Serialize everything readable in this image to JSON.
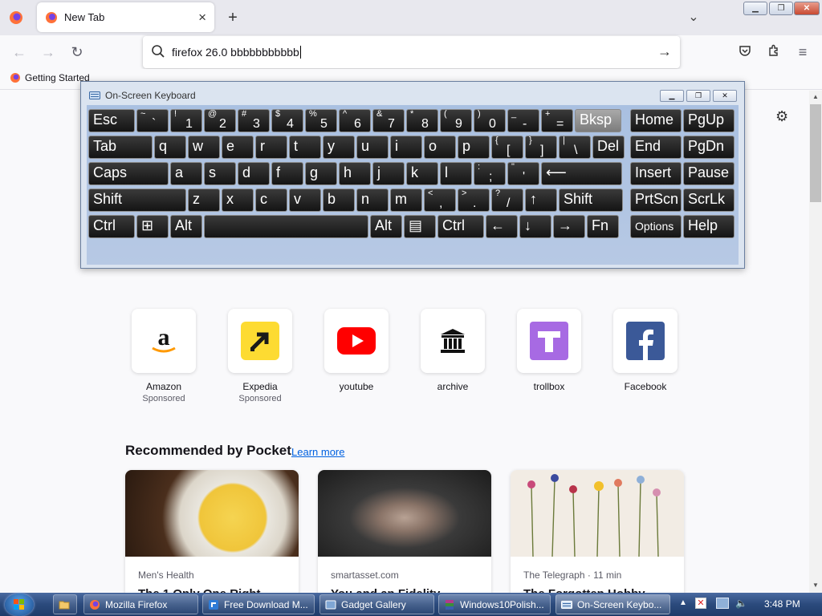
{
  "browser": {
    "tab_title": "New Tab",
    "url_value": "firefox 26.0 bbbbbbbbbbb",
    "bookmark": "Getting Started"
  },
  "osk": {
    "title": "On-Screen Keyboard",
    "rows": [
      [
        {
          "l": "Esc"
        },
        {
          "u": "~",
          "d": "`"
        },
        {
          "u": "!",
          "d": "1"
        },
        {
          "u": "@",
          "d": "2"
        },
        {
          "u": "#",
          "d": "3"
        },
        {
          "u": "$",
          "d": "4"
        },
        {
          "u": "%",
          "d": "5"
        },
        {
          "u": "^",
          "d": "6"
        },
        {
          "u": "&",
          "d": "7"
        },
        {
          "u": "*",
          "d": "8"
        },
        {
          "u": "(",
          "d": "9"
        },
        {
          "u": ")",
          "d": "0"
        },
        {
          "u": "_",
          "d": "-"
        },
        {
          "u": "+",
          "d": "="
        },
        {
          "l": "Bksp"
        },
        {
          "l": "Home"
        },
        {
          "l": "PgUp"
        }
      ],
      [
        {
          "l": "Tab"
        },
        {
          "l": "q"
        },
        {
          "l": "w"
        },
        {
          "l": "e"
        },
        {
          "l": "r"
        },
        {
          "l": "t"
        },
        {
          "l": "y"
        },
        {
          "l": "u"
        },
        {
          "l": "i"
        },
        {
          "l": "o"
        },
        {
          "l": "p"
        },
        {
          "u": "{",
          "d": "["
        },
        {
          "u": "}",
          "d": "]"
        },
        {
          "u": "|",
          "d": "\\"
        },
        {
          "l": "Del"
        },
        {
          "l": "End"
        },
        {
          "l": "PgDn"
        }
      ],
      [
        {
          "l": "Caps"
        },
        {
          "l": "a"
        },
        {
          "l": "s"
        },
        {
          "l": "d"
        },
        {
          "l": "f"
        },
        {
          "l": "g"
        },
        {
          "l": "h"
        },
        {
          "l": "j"
        },
        {
          "l": "k"
        },
        {
          "l": "l"
        },
        {
          "u": ":",
          "d": ";"
        },
        {
          "u": "\"",
          "d": "'"
        },
        {
          "l": "⟵"
        },
        {
          "l": "Insert"
        },
        {
          "l": "Pause"
        }
      ],
      [
        {
          "l": "Shift"
        },
        {
          "l": "z"
        },
        {
          "l": "x"
        },
        {
          "l": "c"
        },
        {
          "l": "v"
        },
        {
          "l": "b"
        },
        {
          "l": "n"
        },
        {
          "l": "m"
        },
        {
          "u": "<",
          "d": ","
        },
        {
          "u": ">",
          "d": "."
        },
        {
          "u": "?",
          "d": "/"
        },
        {
          "l": "↑"
        },
        {
          "l": "Shift"
        },
        {
          "l": "PrtScn"
        },
        {
          "l": "ScrLk"
        }
      ],
      [
        {
          "l": "Ctrl"
        },
        {
          "l": "⊞"
        },
        {
          "l": "Alt"
        },
        {
          "l": ""
        },
        {
          "l": "Alt"
        },
        {
          "l": "▤"
        },
        {
          "l": "Ctrl"
        },
        {
          "l": "←"
        },
        {
          "l": "↓"
        },
        {
          "l": "→"
        },
        {
          "l": "Fn"
        },
        {
          "l": "Options"
        },
        {
          "l": "Help"
        }
      ]
    ]
  },
  "shortcuts": [
    {
      "label": "Amazon",
      "sub": "Sponsored",
      "icon": "amazon-icon"
    },
    {
      "label": "Expedia",
      "sub": "Sponsored",
      "icon": "expedia-icon"
    },
    {
      "label": "youtube",
      "sub": "",
      "icon": "youtube-icon"
    },
    {
      "label": "archive",
      "sub": "",
      "icon": "archive-icon"
    },
    {
      "label": "trollbox",
      "sub": "",
      "icon": "trollbox-icon"
    },
    {
      "label": "Facebook",
      "sub": "",
      "icon": "facebook-icon"
    }
  ],
  "pocket": {
    "heading": "Recommended by Pocket",
    "learn_more": "Learn more",
    "cards": [
      {
        "source": "Men's Health",
        "title": "The 1 Only One Right"
      },
      {
        "source": "smartasset.com",
        "title": "You and an Fidelity"
      },
      {
        "source": "The Telegraph · 11 min",
        "title": "The Forgotten Hobby"
      }
    ]
  },
  "taskbar": {
    "items": [
      "Mozilla Firefox",
      "Free Download M...",
      "Gadget Gallery",
      "Windows10Polish...",
      "On-Screen Keybo..."
    ],
    "clock": "3:48 PM"
  }
}
